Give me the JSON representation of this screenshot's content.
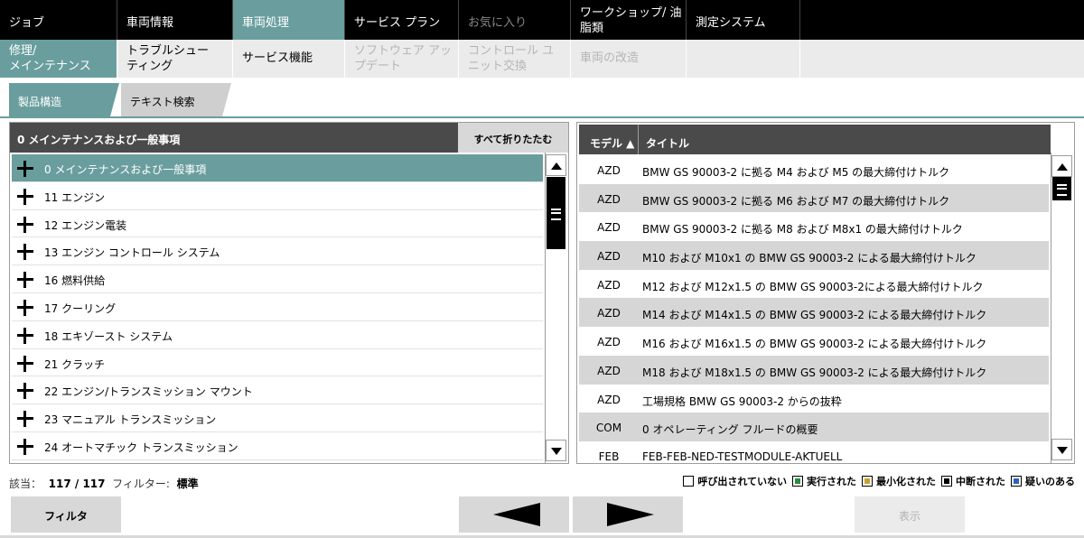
{
  "menu_primary": [
    {
      "label": "ジョブ"
    },
    {
      "label": "車両情報"
    },
    {
      "label": "車両処理"
    },
    {
      "label": "サービス プラン"
    },
    {
      "label": "お気に入り"
    },
    {
      "label_line1": "ワークショップ/ 油",
      "label_line2": "脂類"
    },
    {
      "label": "測定システム"
    }
  ],
  "menu_secondary": [
    {
      "label_line1": "修理/",
      "label_line2": "メインテナンス"
    },
    {
      "label_line1": "トラブルシュー",
      "label_line2": "ティング"
    },
    {
      "label": "サービス機能"
    },
    {
      "label_line1": "ソフトウェア アッ",
      "label_line2": "プデート"
    },
    {
      "label_line1": "コントロール ユ",
      "label_line2": "ニット交換"
    },
    {
      "label": "車両の改造"
    }
  ],
  "tabs": [
    {
      "label": "製品構造"
    },
    {
      "label": "テキスト検索"
    }
  ],
  "left_panel": {
    "header": "0 メインテナンスおよび一般事項",
    "collapse_all": "すべて折りたたむ",
    "items": [
      {
        "label": "0 メインテナンスおよび一般事項"
      },
      {
        "label": "11 エンジン"
      },
      {
        "label": "12 エンジン電装"
      },
      {
        "label": "13 エンジン コントロール システム"
      },
      {
        "label": "16 燃料供給"
      },
      {
        "label": "17 クーリング"
      },
      {
        "label": "18 エキゾースト システム"
      },
      {
        "label": "21 クラッチ"
      },
      {
        "label": "22 エンジン/トランスミッション マウント"
      },
      {
        "label": "23 マニュアル トランスミッション"
      },
      {
        "label": "24 オートマチック トランスミッション"
      }
    ]
  },
  "right_panel": {
    "col_model": "モデル ▲",
    "col_title": "タイトル",
    "rows": [
      {
        "model": "AZD",
        "title": "BMW GS 90003-2 に拠る M4 および M5 の最大締付けトルク"
      },
      {
        "model": "AZD",
        "title": "BMW GS 90003-2 に拠る M6 および M7 の最大締付けトルク"
      },
      {
        "model": "AZD",
        "title": "BMW GS 90003-2 に拠る M8 および M8x1 の最大締付けトルク"
      },
      {
        "model": "AZD",
        "title": "M10 および M10x1 の BMW GS 90003-2 による最大締付けトルク"
      },
      {
        "model": "AZD",
        "title": "M12 および M12x1.5 の BMW GS 90003-2による最大締付けトルク"
      },
      {
        "model": "AZD",
        "title": "M14 および M14x1.5 の BMW GS 90003-2 による最大締付けトルク"
      },
      {
        "model": "AZD",
        "title": "M16 および M16x1.5 の BMW GS 90003-2 による最大締付けトルク"
      },
      {
        "model": "AZD",
        "title": "M18 および M18x1.5 の BMW GS 90003-2 による最大締付けトルク"
      },
      {
        "model": "AZD",
        "title": "工場規格 BMW GS 90003-2 からの抜粋"
      },
      {
        "model": "COM",
        "title": "0 オペレーティング フルードの概要"
      },
      {
        "model": "FEB",
        "title": "FEB-FEB-NED-TESTMODULE-AKTUELL"
      }
    ]
  },
  "status": {
    "hits_label": "該当：",
    "hits_value": "117 / 117",
    "filter_label": "フィルター:",
    "filter_value": "標準"
  },
  "legend": [
    {
      "label": "呼び出されていない",
      "color": "#ffffff"
    },
    {
      "label": "実行された",
      "color": "#2e8b3e"
    },
    {
      "label": "最小化された",
      "color": "#c8a030"
    },
    {
      "label": "中断された",
      "color": "#000000"
    },
    {
      "label": "疑いのある",
      "color": "#3060c0"
    }
  ],
  "buttons": {
    "filter": "フィルタ",
    "show": "表示"
  },
  "colors": {
    "accent": "#6a9e9e",
    "header_dark": "#4a4a4a",
    "menu_bg": "#000000"
  }
}
